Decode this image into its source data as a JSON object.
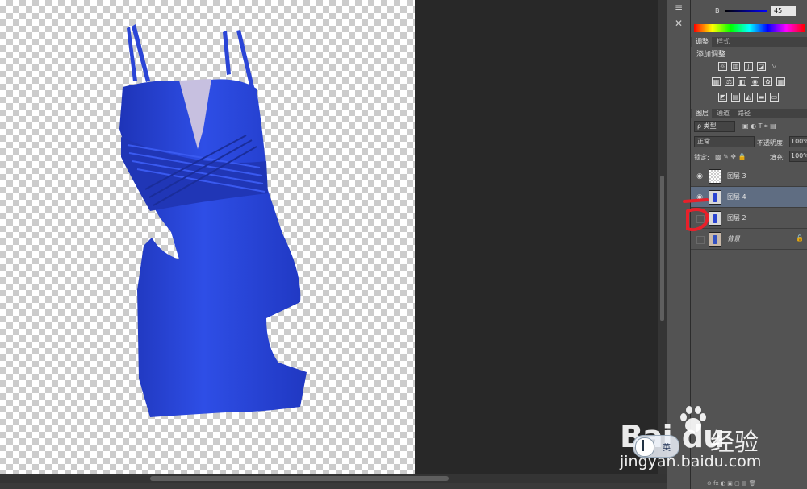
{
  "colors": {
    "canvas_bg": "#282828",
    "dress": "#2a46d8",
    "selection": "#5f6d82",
    "annotation": "#e8202a"
  },
  "color_panel": {
    "b_label": "B",
    "b_value": "45"
  },
  "adjust_panel": {
    "tabs": [
      "调整",
      "样式"
    ],
    "title": "添加调整",
    "icon_rows": [
      [
        "brightness-icon",
        "levels-icon",
        "curves-icon",
        "exposure-icon",
        "vibrance-icon"
      ],
      [
        "hue-saturation-icon",
        "color-balance-icon",
        "black-white-icon",
        "photo-filter-icon",
        "channel-mixer-icon",
        "color-lookup-icon"
      ],
      [
        "invert-icon",
        "posterize-icon",
        "threshold-icon",
        "gradient-map-icon",
        "selective-color-icon"
      ]
    ]
  },
  "layers_panel": {
    "tabs": [
      "图层",
      "通道",
      "路径"
    ],
    "filter_label": "ρ 类型",
    "blend_mode": "正常",
    "opacity_label": "不透明度:",
    "opacity_value": "100%",
    "lock_label": "锁定:",
    "fill_label": "填充:",
    "fill_value": "100%",
    "layers": [
      {
        "name": "图层 3",
        "visible": true,
        "selected": false,
        "thumb": "transparent"
      },
      {
        "name": "图层 4",
        "visible": true,
        "selected": true,
        "thumb": "dress"
      },
      {
        "name": "图层 2",
        "visible": false,
        "selected": false,
        "thumb": "dress"
      },
      {
        "name": "背景",
        "visible": false,
        "selected": false,
        "thumb": "background",
        "locked": true
      }
    ]
  },
  "annotation": {
    "text": "D"
  },
  "ime": {
    "lang": "英"
  },
  "watermark": {
    "logo": "Bai du",
    "cn": "经验",
    "url": "jingyan.baidu.com"
  }
}
